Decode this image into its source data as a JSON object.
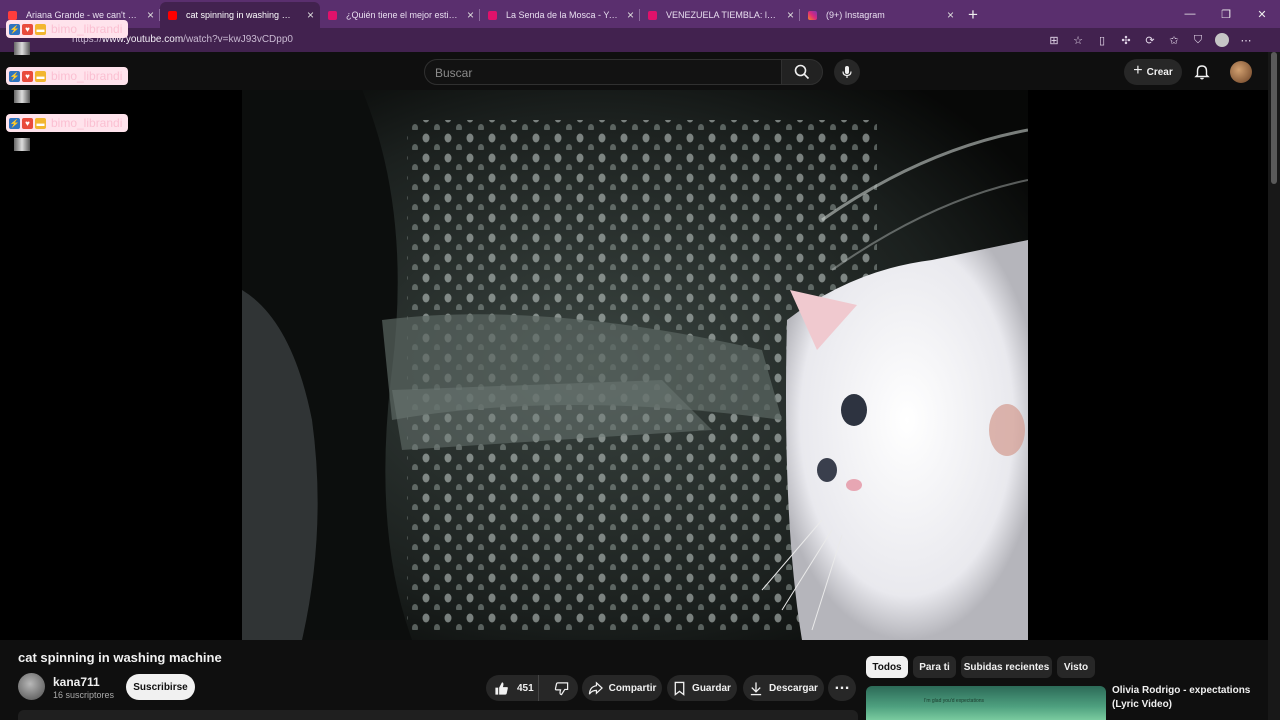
{
  "browser": {
    "tabs": [
      {
        "title": "Ariana Grande - we can't be fr",
        "icon_color": "#ff3d3d",
        "active": false
      },
      {
        "title": "cat spinning in washing machine",
        "icon_color": "#ff0000",
        "active": true
      },
      {
        "title": "¿Quién tiene el mejor estilo? Lit Kil",
        "icon_color": "#e0116b",
        "active": false
      },
      {
        "title": "La Senda de la Mosca - YouTube",
        "icon_color": "#e0116b",
        "active": false
      },
      {
        "title": "VENEZUELA TIEMBLA: los héroes",
        "icon_color": "#e0116b",
        "active": false
      },
      {
        "title": "(9+) Instagram",
        "icon_color": "#d62976",
        "active": false
      }
    ],
    "new_tab": "+",
    "window_controls": [
      "—",
      "❐",
      "✕"
    ],
    "url_prefix": "https://",
    "url_main": "www.youtube.com",
    "url_rest": "/watch?v=kwJ93vCDpp0"
  },
  "overlay": {
    "username": "bimo_librandi"
  },
  "youtube": {
    "search_placeholder": "Buscar",
    "create_label": "Crear",
    "video": {
      "title": "cat spinning in washing machine",
      "channel": "kana711",
      "subscribers": "16 suscriptores",
      "subscribe_label": "Suscribirse",
      "likes": "451",
      "share_label": "Compartir",
      "save_label": "Guardar",
      "download_label": "Descargar"
    },
    "chips": [
      "Todos",
      "Para ti",
      "Subidas recientes",
      "Visto"
    ],
    "recommended": {
      "title": "Olivia Rodrigo - expectations (Lyric Video)",
      "thumb_text": "I'm glad you'd expectations"
    }
  },
  "colors": {
    "browser_frame": "#5a2f6e",
    "youtube_bg": "#0f0f0f",
    "pill_bg": "#272727"
  }
}
